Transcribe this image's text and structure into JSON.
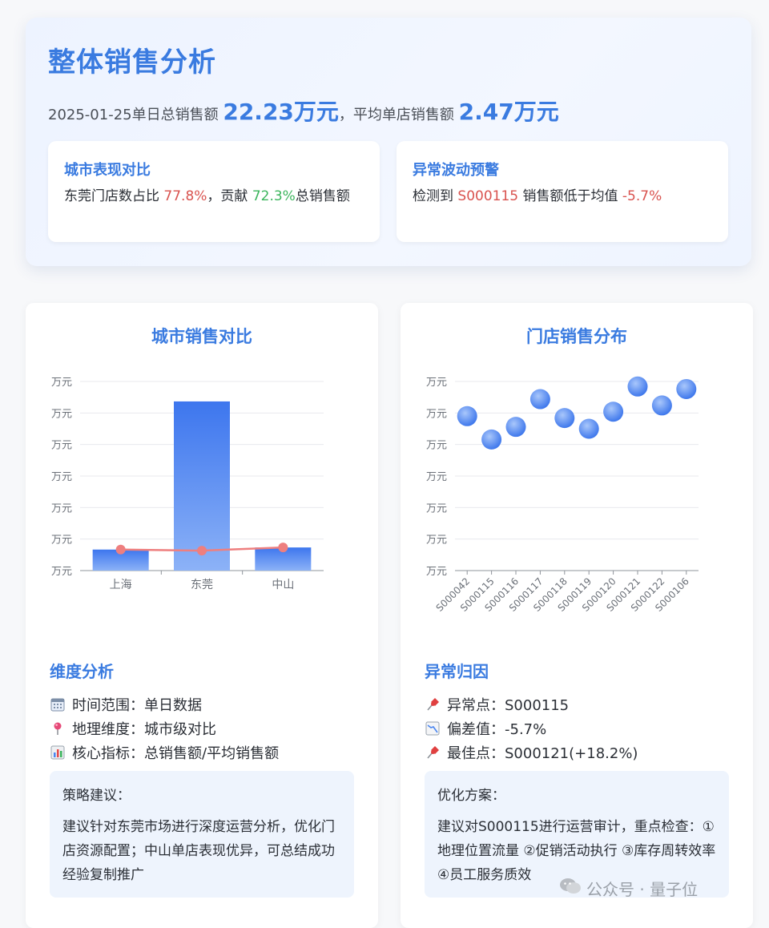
{
  "header": {
    "title": "整体销售分析",
    "date_prefix": "2025-01-25单日总销售额",
    "total_sales": "22.23万元",
    "separator": "，平均单店销售额",
    "avg_sales": "2.47万元"
  },
  "city_box": {
    "title": "城市表现对比",
    "text_1": "东莞门店数占比",
    "store_share": "77.8%",
    "text_2": "，贡献",
    "sales_share": "72.3%",
    "text_3": "总销售额"
  },
  "alert_box": {
    "title": "异常波动预警",
    "text_1": "检测到",
    "store_id": "S000115",
    "text_2": "销售额低于均值",
    "deviation": "-5.7%"
  },
  "city_chart": {
    "title": "城市销售对比",
    "chart_data": {
      "type": "bar",
      "categories": [
        "上海",
        "东莞",
        "中山"
      ],
      "series": [
        {
          "kind": "bar",
          "values": [
            2.0,
            16.1,
            2.2
          ]
        },
        {
          "kind": "line",
          "values": [
            2.0,
            1.9,
            2.2
          ]
        }
      ],
      "ylim": [
        0,
        18
      ],
      "ytick_labels": [
        "万元",
        "万元",
        "万元",
        "万元",
        "万元",
        "万元",
        "万元"
      ],
      "grid": true,
      "bar_color": "#4a86f0",
      "line_color": "#ee7f7f"
    }
  },
  "store_chart": {
    "title": "门店销售分布",
    "chart_data": {
      "type": "scatter",
      "categories": [
        "S000042",
        "S000115",
        "S000116",
        "S000117",
        "S000118",
        "S000119",
        "S000120",
        "S000121",
        "S000122",
        "S000106"
      ],
      "values": [
        2.45,
        2.08,
        2.28,
        2.72,
        2.42,
        2.25,
        2.52,
        2.92,
        2.62,
        2.88
      ],
      "ylim": [
        0,
        3.0
      ],
      "ytick_labels": [
        "万元",
        "万元",
        "万元",
        "万元",
        "万元",
        "万元",
        "万元"
      ],
      "grid": true,
      "point_color": "#4a86f0"
    }
  },
  "dimension": {
    "title": "维度分析",
    "items": [
      {
        "icon": "calendar-icon",
        "text": "时间范围：单日数据"
      },
      {
        "icon": "location-pin-icon",
        "text": "地理维度：城市级对比"
      },
      {
        "icon": "bar-chart-icon",
        "text": "核心指标：总销售额/平均销售额"
      }
    ],
    "box_title": "策略建议：",
    "box_text": "建议针对东莞市场进行深度运营分析，优化门店资源配置；中山单店表现优异，可总结成功经验复制推广"
  },
  "anomaly": {
    "title": "异常归因",
    "items": [
      {
        "icon": "pushpin-icon",
        "text": "异常点：S000115"
      },
      {
        "icon": "chart-decreasing-icon",
        "text": "偏差值：-5.7%"
      },
      {
        "icon": "pushpin-icon",
        "text": "最佳点：S000121(+18.2%)"
      }
    ],
    "box_title": "优化方案：",
    "box_text": "建议对S000115进行运营审计，重点检查：①地理位置流量 ②促销活动执行 ③库存周转效率 ④员工服务质效"
  },
  "watermark": {
    "text": "公众号 · 量子位",
    "icon": "wechat-icon"
  }
}
